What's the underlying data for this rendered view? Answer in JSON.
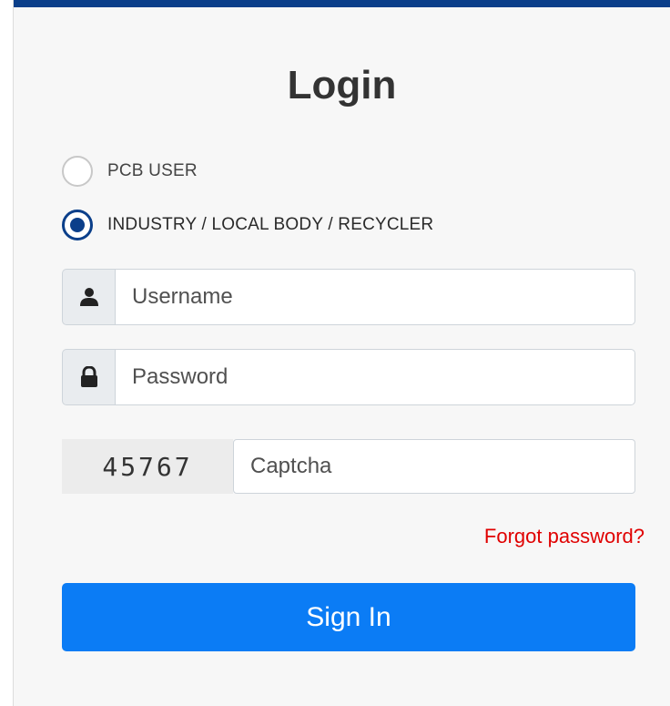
{
  "login": {
    "title": "Login",
    "user_types": [
      {
        "label": "PCB USER",
        "selected": false
      },
      {
        "label": "INDUSTRY / LOCAL BODY / RECYCLER",
        "selected": true
      }
    ],
    "username": {
      "placeholder": "Username",
      "value": "",
      "icon": "user-icon"
    },
    "password": {
      "placeholder": "Password",
      "value": "",
      "icon": "lock-icon"
    },
    "captcha": {
      "code": "45767",
      "placeholder": "Captcha",
      "value": ""
    },
    "forgot_label": "Forgot password?",
    "signin_label": "Sign In"
  },
  "colors": {
    "top_bar": "#0b3f8a",
    "radio_selected": "#0b3f8a",
    "forgot_link": "#e00000",
    "signin_button": "#0b7cf5",
    "panel_bg": "#f7f7f7"
  }
}
